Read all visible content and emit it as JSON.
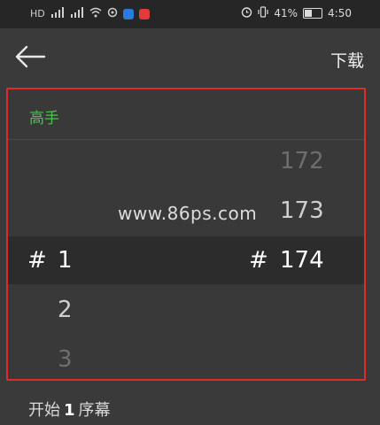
{
  "status_bar": {
    "left_icons": [
      "hd-icon",
      "signal-icon",
      "signal-icon",
      "wifi-icon",
      "sync-icon",
      "app-badge-blue",
      "app-badge-red"
    ],
    "battery_percent": "41%",
    "time": "4:50"
  },
  "header": {
    "back_icon": "arrow-left-icon",
    "download_label": "下载"
  },
  "picker": {
    "title": "高手",
    "watermark": "www.86ps.com",
    "left_column": {
      "selected_prefix": "#",
      "values": [
        "1",
        "2",
        "3"
      ]
    },
    "right_column": {
      "selected_prefix": "#",
      "values": [
        "172",
        "173",
        "174"
      ]
    },
    "highlight_color": "#2c2c2c",
    "border_color": "#e02b2b",
    "title_color": "#4bc34e"
  },
  "footer": {
    "prefix": "开始",
    "number": "1",
    "suffix": "序幕"
  }
}
